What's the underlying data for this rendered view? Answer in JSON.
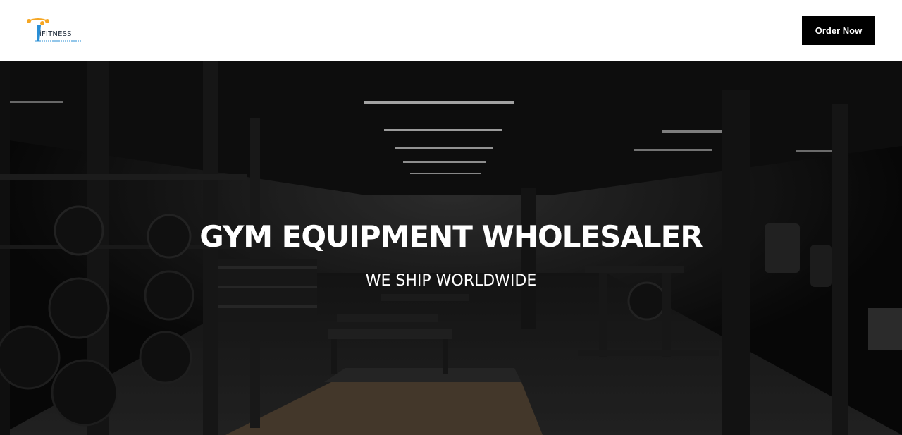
{
  "header": {
    "logo_text": "iFITNESS",
    "order_button": "Order Now"
  },
  "hero": {
    "title": "GYM EQUIPMENT WHOLESALER",
    "subtitle": "WE SHIP WORLDWIDE"
  },
  "colors": {
    "header_bg": "#ffffff",
    "button_bg": "#000000",
    "button_text": "#ffffff",
    "hero_text": "#ffffff",
    "logo_blue": "#2a8fd6",
    "logo_orange": "#f5a623"
  }
}
